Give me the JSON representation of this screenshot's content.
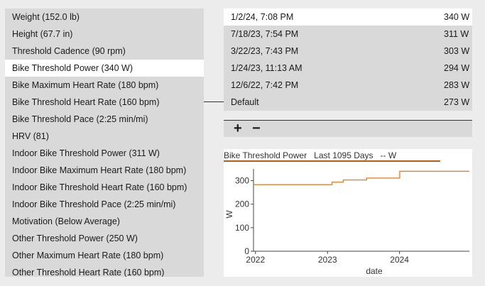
{
  "metrics_list": [
    {
      "label": "Weight (152.0 lb)"
    },
    {
      "label": "Height (67.7 in)"
    },
    {
      "label": "Threshold Cadence (90 rpm)"
    },
    {
      "label": "Bike Threshold Power (340 W)",
      "selected": true
    },
    {
      "label": "Bike Maximum Heart Rate (180 bpm)"
    },
    {
      "label": "Bike Threshold Heart Rate (160 bpm)"
    },
    {
      "label": "Bike Threshold Pace (2:25 min/mi)"
    },
    {
      "label": "HRV (81)"
    },
    {
      "label": "Indoor Bike Threshold Power (311 W)"
    },
    {
      "label": "Indoor Bike Maximum Heart Rate (180 bpm)"
    },
    {
      "label": "Indoor Bike Threshold Heart Rate (160 bpm)"
    },
    {
      "label": "Indoor Bike Threshold Pace (2:25 min/mi)"
    },
    {
      "label": "Motivation (Below Average)"
    },
    {
      "label": "Other Threshold Power (250 W)"
    },
    {
      "label": "Other Maximum Heart Rate (180 bpm)"
    },
    {
      "label": "Other Threshold Heart Rate (160 bpm)"
    }
  ],
  "history": [
    {
      "date": "1/2/24, 7:08 PM",
      "value": "340 W",
      "selected": true
    },
    {
      "date": "7/18/23, 7:54 PM",
      "value": "311 W"
    },
    {
      "date": "3/22/23, 7:43 PM",
      "value": "303 W"
    },
    {
      "date": "1/24/23, 11:13 AM",
      "value": "294 W"
    },
    {
      "date": "12/6/22, 7:42 PM",
      "value": "283 W"
    },
    {
      "date": "Default",
      "value": "273 W"
    }
  ],
  "toolbar": {
    "add_label": "+",
    "remove_label": "−"
  },
  "chart_title": "Bike Threshold Power   Last 1095 Days   -- W",
  "chart_data": {
    "type": "line",
    "title": "Bike Threshold Power   Last 1095 Days   -- W",
    "xlabel": "date",
    "ylabel": "W",
    "x_tick_labels": [
      "2022",
      "2023",
      "2024"
    ],
    "y_tick_labels": [
      "0",
      "100",
      "200",
      "300"
    ],
    "ylim": [
      0,
      350
    ],
    "xlim": [
      "2021-12-22",
      "2024-12-20"
    ],
    "series": [
      {
        "color": "#e8822a",
        "step": true,
        "points": [
          {
            "x": "2021-12-22",
            "y": 283
          },
          {
            "x": "2023-01-24",
            "y": 294
          },
          {
            "x": "2023-03-22",
            "y": 303
          },
          {
            "x": "2023-07-18",
            "y": 311
          },
          {
            "x": "2024-01-02",
            "y": 340
          },
          {
            "x": "2024-12-20",
            "y": 340
          }
        ]
      }
    ],
    "grid": false
  },
  "colors": {
    "accent": "#e8822a",
    "title_underline": "#c05a10"
  }
}
